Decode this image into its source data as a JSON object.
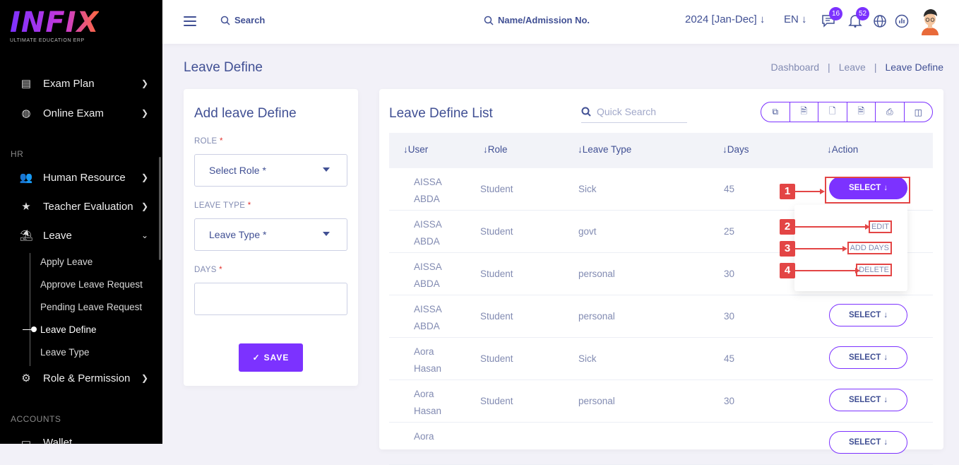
{
  "brand": {
    "logo_text": "INFIX",
    "logo_sub": "ULTIMATE EDUCATION ERP"
  },
  "sidebar": {
    "items": [
      {
        "label": "Exam Plan",
        "icon": "clipboard-icon"
      },
      {
        "label": "Online Exam",
        "icon": "globe-icon"
      },
      {
        "label": "Human Resource",
        "icon": "users-icon"
      },
      {
        "label": "Teacher Evaluation",
        "icon": "star-icon"
      },
      {
        "label": "Leave",
        "icon": "beach-icon"
      },
      {
        "label": "Role & Permission",
        "icon": "shield-icon"
      },
      {
        "label": "Wallet",
        "icon": "wallet-icon"
      }
    ],
    "sections": {
      "hr": "HR",
      "accounts": "ACCOUNTS"
    },
    "leave_sub": [
      "Apply Leave",
      "Approve Leave Request",
      "Pending Leave Request",
      "Leave Define",
      "Leave Type"
    ]
  },
  "topbar": {
    "search": "Search",
    "search2": "Name/Admission No.",
    "session": "2024 [Jan-Dec]",
    "lang": "EN",
    "chat_badge": "16",
    "notif_badge": "52"
  },
  "page": {
    "title": "Leave Define",
    "breadcrumb": [
      "Dashboard",
      "|",
      "Leave",
      "|",
      "Leave Define"
    ]
  },
  "form": {
    "title": "Add leave Define",
    "role_label": "ROLE",
    "role_placeholder": "Select Role *",
    "leave_type_label": "LEAVE TYPE",
    "leave_type_placeholder": "Leave Type *",
    "days_label": "DAYS",
    "req": "*",
    "save_label": "SAVE"
  },
  "list": {
    "title": "Leave Define List",
    "quick_search_placeholder": "Quick Search",
    "headers": [
      "User",
      "Role",
      "Leave Type",
      "Days",
      "Action"
    ],
    "select_label": "SELECT",
    "rows": [
      {
        "user1": "AISSA",
        "user2": "ABDA",
        "role": "Student",
        "type": "Sick",
        "days": "45"
      },
      {
        "user1": "AISSA",
        "user2": "ABDA",
        "role": "Student",
        "type": "govt",
        "days": "25"
      },
      {
        "user1": "AISSA",
        "user2": "ABDA",
        "role": "Student",
        "type": "personal",
        "days": "30"
      },
      {
        "user1": "AISSA",
        "user2": "ABDA",
        "role": "Student",
        "type": "personal",
        "days": "30"
      },
      {
        "user1": "Aora",
        "user2": "Hasan",
        "role": "Student",
        "type": "Sick",
        "days": "45"
      },
      {
        "user1": "Aora",
        "user2": "Hasan",
        "role": "Student",
        "type": "personal",
        "days": "30"
      },
      {
        "user1": "Aora",
        "user2": "",
        "role": "",
        "type": "",
        "days": ""
      }
    ],
    "dropdown": [
      "EDIT",
      "ADD DAYS",
      "DELETE"
    ]
  },
  "annotations": [
    "1",
    "2",
    "3",
    "4"
  ],
  "colors": {
    "accent": "#7c32ff",
    "text": "#415094",
    "muted": "#828bb2",
    "annotation": "#e34545"
  }
}
